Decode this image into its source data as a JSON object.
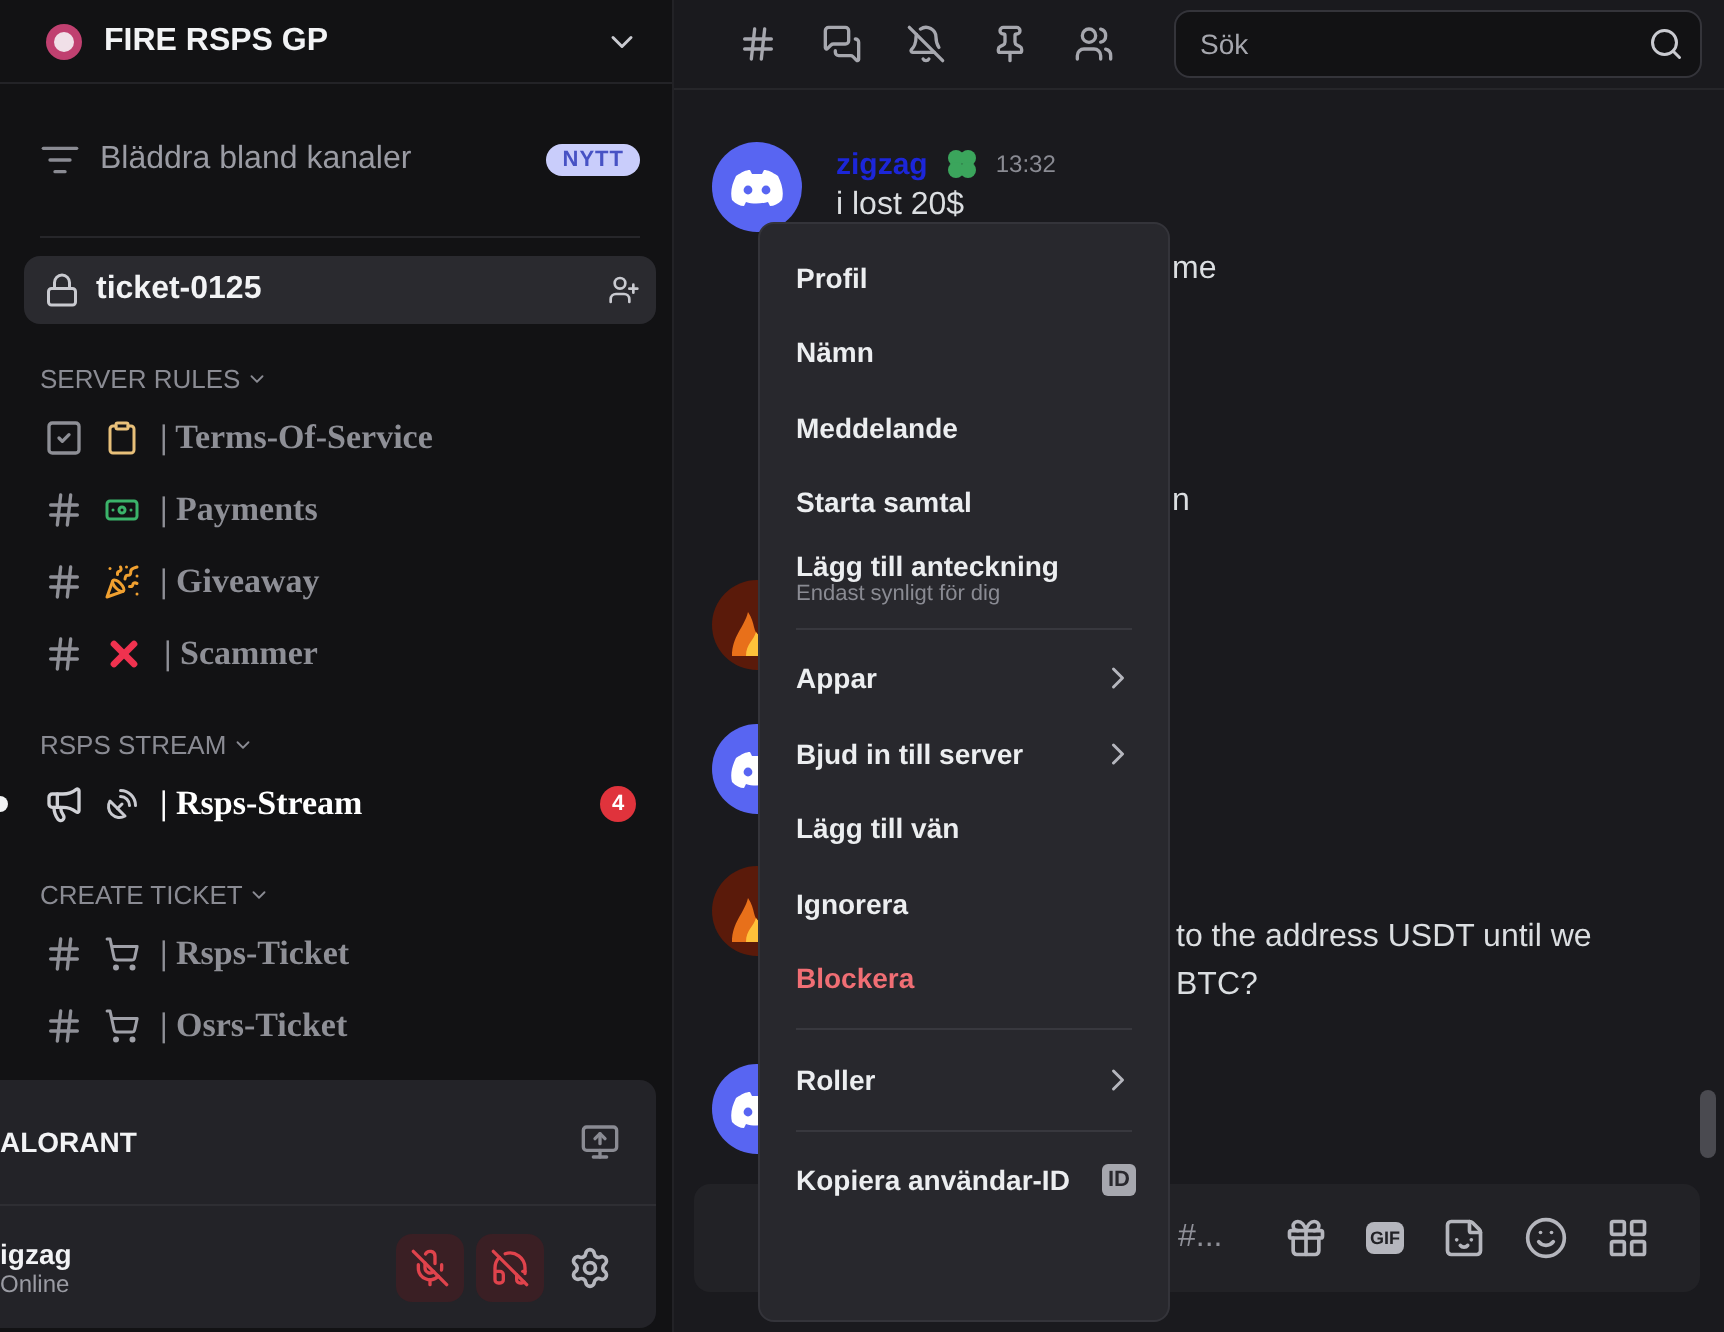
{
  "server": {
    "name": "FIRE RSPS GP"
  },
  "browse": {
    "label": "Bläddra bland kanaler",
    "badge": "NYTT"
  },
  "top_channels": [
    {
      "name": "ticket-0125",
      "selected": true
    }
  ],
  "categories": [
    {
      "name": "SERVER RULES",
      "channels": [
        {
          "kind": "rules",
          "name": "| Terms-Of-Service",
          "unread": false
        },
        {
          "kind": "text",
          "name": "| Payments",
          "unread": false
        },
        {
          "kind": "text",
          "name": "| Giveaway",
          "unread": false
        },
        {
          "kind": "text",
          "name": "| Scammer",
          "unread": false
        }
      ]
    },
    {
      "name": "RSPS STREAM",
      "channels": [
        {
          "kind": "announcement",
          "name": "| Rsps-Stream",
          "unread": true,
          "badge": "4"
        }
      ]
    },
    {
      "name": "CREATE TICKET",
      "channels": [
        {
          "kind": "text",
          "name": "| Rsps-Ticket",
          "unread": false
        },
        {
          "kind": "text",
          "name": "| Osrs-Ticket",
          "unread": false
        }
      ]
    }
  ],
  "activity": {
    "title": "ALORANT"
  },
  "user": {
    "name": "igzag",
    "status": "Online",
    "muted": true,
    "deafened": true
  },
  "search": {
    "placeholder": "Sök"
  },
  "messages": [
    {
      "kind": "discord",
      "author": "zigzag",
      "time": "13:32",
      "lines": [
        "i lost 20$"
      ]
    },
    {
      "lines": [
        "me"
      ]
    },
    {
      "lines": [
        "n"
      ]
    },
    {
      "kind": "fire"
    },
    {
      "kind": "discord"
    },
    {
      "kind": "fire",
      "lines": [
        "to the address  USDT until we",
        "BTC?"
      ]
    },
    {
      "kind": "discord"
    }
  ],
  "composer": {
    "placeholder": "#...",
    "gif": "GIF"
  },
  "menu": {
    "groups": [
      [
        {
          "label": "Profil"
        },
        {
          "label": "Nämn"
        },
        {
          "label": "Meddelande"
        },
        {
          "label": "Starta samtal"
        },
        {
          "label": "Lägg till anteckning",
          "subtitle": "Endast synligt för dig"
        }
      ],
      [
        {
          "label": "Appar",
          "submenu": true
        },
        {
          "label": "Bjud in till server",
          "submenu": true
        },
        {
          "label": "Lägg till vän"
        },
        {
          "label": "Ignorera"
        },
        {
          "label": "Blockera",
          "danger": true
        }
      ],
      [
        {
          "label": "Roller",
          "submenu": true
        }
      ],
      [
        {
          "label": "Kopiera användar-ID",
          "badge": "ID"
        }
      ]
    ]
  }
}
